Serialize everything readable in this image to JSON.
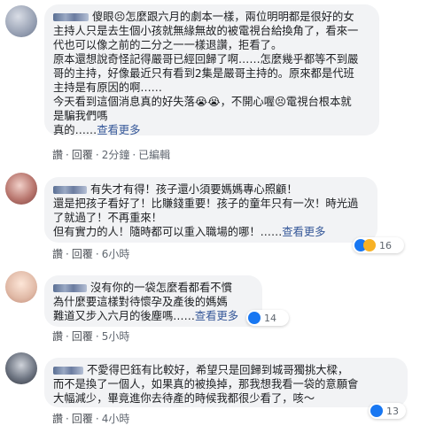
{
  "comments": [
    {
      "lines": [
        "傻眼😣怎麼跟六月的劇本一樣，兩位明明都是很好的女",
        "主持人只是去生個小孩就無緣無故的被電視台給換角了，看來一",
        "代也可以像之前的二分之一一樣退讚，拒看了。",
        "原本還想說奇怪記得嚴哥已經回歸了啊……怎麼幾乎都等不到嚴",
        "哥的主持，好像最近只有看到2集是嚴哥主持的。原來都是代班",
        "主持是有原因的啊……",
        "今天看到這個消息真的好失落😭😭，不開心喔😣電視台根本就",
        "是騙我們嗎",
        "真的……"
      ],
      "see_more": "查看更多",
      "actions": {
        "like": "讚",
        "reply": "回覆",
        "time": "2分鐘",
        "edited": "已編輯"
      }
    },
    {
      "lines": [
        "有失才有得！孩子還小須要媽媽專心照顧！",
        "還是把孩子看好了！比賺錢重要！孩子的童年只有一次！時光過",
        "了就過了！不再重來！",
        "但有實力的人！隨時都可以重入職場的哪！……"
      ],
      "see_more": "查看更多",
      "actions": {
        "like": "讚",
        "reply": "回覆",
        "time": "6小時"
      },
      "reaction_count": "16"
    },
    {
      "lines": [
        "沒有你的一袋怎麼看都看不慣",
        "為什麼要這樣對待懷孕及產後的媽媽",
        "難道又步入六月的後塵嗎……"
      ],
      "see_more": "查看更多",
      "actions": {
        "like": "讚",
        "reply": "回覆",
        "time": "5小時"
      },
      "reaction_count": "14"
    },
    {
      "lines": [
        "不愛得巴鈺有比較好，希望只是回歸到城哥獨挑大樑，",
        "而不是換了一個人，如果真的被換掉，那我想我看一袋的意願會",
        "大幅減少，畢竟進你去待產的時候我都很少看了，咳～"
      ],
      "actions": {
        "like": "讚",
        "reply": "回覆",
        "time": "4小時"
      },
      "reaction_count": "13"
    }
  ],
  "colors": {
    "bubble": "#f2f3f5",
    "link": "#365899",
    "like": "#1877f2",
    "haha": "#f7b125"
  }
}
